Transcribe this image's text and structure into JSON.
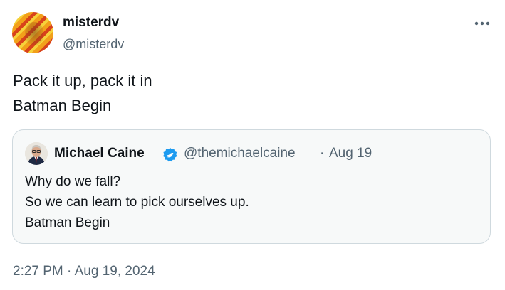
{
  "author": {
    "display_name": "misterdv",
    "handle": "@misterdv"
  },
  "tweet": {
    "lines": [
      "Pack it up, pack it in",
      "Batman Begin"
    ]
  },
  "quoted_tweet": {
    "display_name": "Michael Caine",
    "handle": "@themichaelcaine",
    "separator": "·",
    "date": "Aug 19",
    "verified": true,
    "lines": [
      "Why do we fall?",
      "So we can learn to pick ourselves up.",
      "Batman Begin"
    ]
  },
  "meta": {
    "time": "2:27 PM",
    "separator": "·",
    "date": "Aug 19, 2024"
  },
  "colors": {
    "text_primary": "#0f1419",
    "text_secondary": "#536471",
    "verified_blue": "#1d9bf0",
    "border": "#cfd9de"
  }
}
